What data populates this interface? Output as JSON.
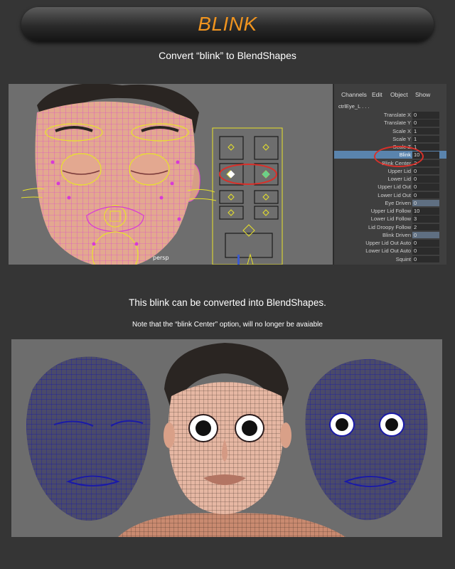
{
  "banner": {
    "title": "BLINK"
  },
  "heading_top": "Convert “blink” to BlendShapes",
  "heading_mid": "This blink can be converted into BlendShapes.",
  "note": "Note that the “blink Center” option, will no longer be avaiable",
  "viewport": {
    "label": "persp"
  },
  "channel_box": {
    "menu": [
      "Channels",
      "Edit",
      "Object",
      "Show"
    ],
    "node_name": "ctrlEye_L . . .",
    "attributes": [
      {
        "label": "Translate X",
        "value": "0"
      },
      {
        "label": "Translate Y",
        "value": "0"
      },
      {
        "label": "Scale X",
        "value": "1"
      },
      {
        "label": "Scale Y",
        "value": "1"
      },
      {
        "label": "Scale Z",
        "value": "1"
      },
      {
        "label": "Blink",
        "value": "10"
      },
      {
        "label": "Blink Center",
        "value": "2"
      },
      {
        "label": "Upper Lid",
        "value": "0"
      },
      {
        "label": "Lower Lid",
        "value": "0"
      },
      {
        "label": "Upper Lid Out",
        "value": "0"
      },
      {
        "label": "Lower Lid Out",
        "value": "0"
      },
      {
        "label": "Eye Driven",
        "value": "0"
      },
      {
        "label": "Upper Lid Follow",
        "value": "10"
      },
      {
        "label": "Lower Lid Follow",
        "value": "3"
      },
      {
        "label": "Lid Droopy Follow",
        "value": "2"
      },
      {
        "label": "Blink Driven",
        "value": "0"
      },
      {
        "label": "Upper Lid Out Auto",
        "value": "0"
      },
      {
        "label": "Lower Lid Out Auto",
        "value": "0"
      },
      {
        "label": "Squint",
        "value": "0"
      }
    ],
    "selected_attribute": "Blink",
    "driven_attributes": [
      "Eye Driven",
      "Blink Driven"
    ],
    "circled_attribute": "Blink Center"
  },
  "colors": {
    "accent": "#f0941f",
    "highlight_circle": "#d9302a",
    "selected_row": "#5a84ad",
    "wireframe_magenta": "#d838d8",
    "control_yellow": "#e8e22a",
    "blendshape_wire_blue": "#1a1aa8"
  }
}
